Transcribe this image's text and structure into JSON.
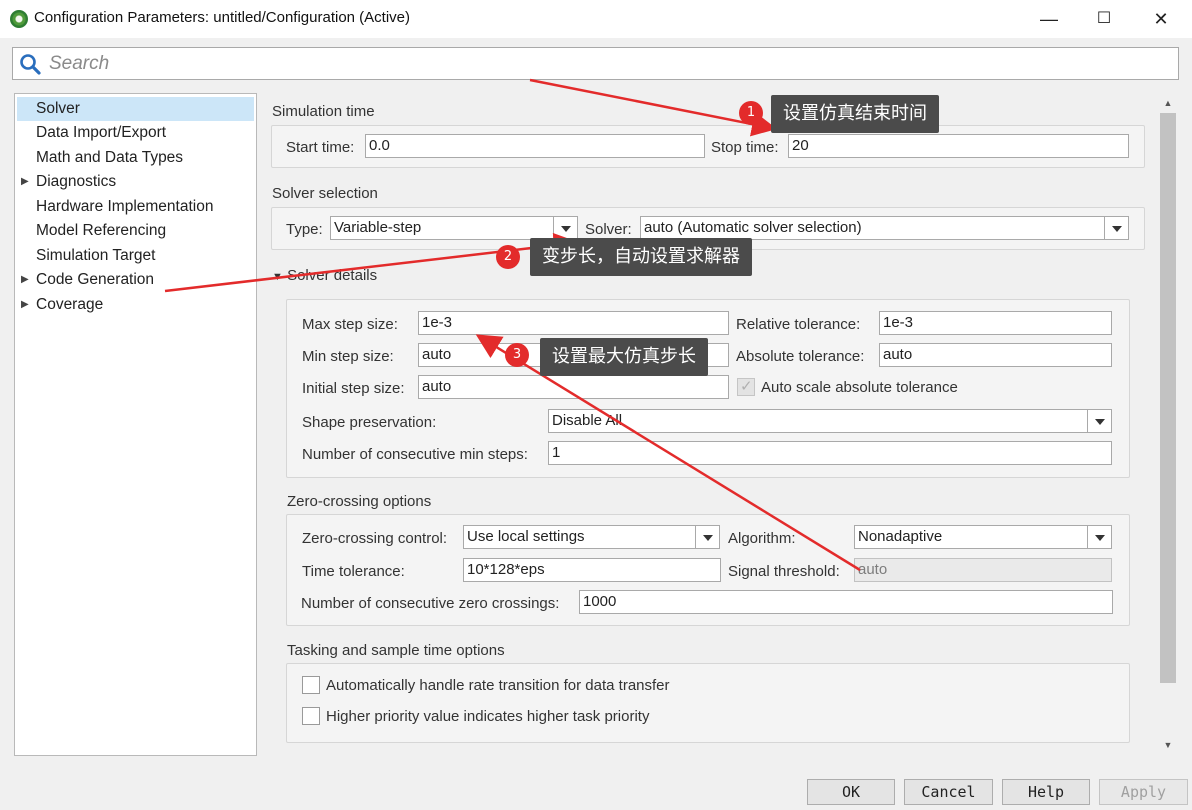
{
  "window": {
    "title": "Configuration Parameters: untitled/Configuration (Active)",
    "minimize": "—",
    "maximize": "☐",
    "close": "✕"
  },
  "search": {
    "placeholder": "Search"
  },
  "tree": {
    "items": [
      {
        "label": "Solver",
        "selected": true,
        "expandable": false
      },
      {
        "label": "Data Import/Export",
        "expandable": false
      },
      {
        "label": "Math and Data Types",
        "expandable": false
      },
      {
        "label": "Diagnostics",
        "expandable": true
      },
      {
        "label": "Hardware Implementation",
        "expandable": false
      },
      {
        "label": "Model Referencing",
        "expandable": false
      },
      {
        "label": "Simulation Target",
        "expandable": false
      },
      {
        "label": "Code Generation",
        "expandable": true
      },
      {
        "label": "Coverage",
        "expandable": true
      }
    ]
  },
  "simulation_time": {
    "title": "Simulation time",
    "start_label": "Start time:",
    "start_value": "0.0",
    "stop_label": "Stop time:",
    "stop_value": "20"
  },
  "solver_selection": {
    "title": "Solver selection",
    "type_label": "Type:",
    "type_value": "Variable-step",
    "solver_label": "Solver:",
    "solver_value": "auto (Automatic solver selection)"
  },
  "solver_details": {
    "title": "Solver details",
    "max_step_label": "Max step size:",
    "max_step_value": "1e-3",
    "min_step_label": "Min step size:",
    "min_step_value": "auto",
    "initial_step_label": "Initial step size:",
    "initial_step_value": "auto",
    "rel_tol_label": "Relative tolerance:",
    "rel_tol_value": "1e-3",
    "abs_tol_label": "Absolute tolerance:",
    "abs_tol_value": "auto",
    "auto_scale_label": "Auto scale absolute tolerance",
    "shape_label": "Shape preservation:",
    "shape_value": "Disable All",
    "consec_min_label": "Number of consecutive min steps:",
    "consec_min_value": "1"
  },
  "zero_crossing": {
    "title": "Zero-crossing options",
    "control_label": "Zero-crossing control:",
    "control_value": "Use local settings",
    "algorithm_label": "Algorithm:",
    "algorithm_value": "Nonadaptive",
    "time_tol_label": "Time tolerance:",
    "time_tol_value": "10*128*eps",
    "signal_thr_label": "Signal threshold:",
    "signal_thr_value": "auto",
    "consec_zc_label": "Number of consecutive zero crossings:",
    "consec_zc_value": "1000"
  },
  "tasking": {
    "title": "Tasking and sample time options",
    "rate_transition_label": "Automatically handle rate transition for data transfer",
    "priority_label": "Higher priority value indicates higher task priority"
  },
  "buttons": {
    "ok": "OK",
    "cancel": "Cancel",
    "help": "Help",
    "apply": "Apply"
  },
  "annotations": [
    {
      "num": "1",
      "text": "设置仿真结束时间"
    },
    {
      "num": "2",
      "text": "变步长，自动设置求解器"
    },
    {
      "num": "3",
      "text": "设置最大仿真步长"
    }
  ],
  "colors": {
    "selection": "#cce6f8",
    "annotation_red": "#e32b2b",
    "callout_bg": "#4b4b4b"
  }
}
